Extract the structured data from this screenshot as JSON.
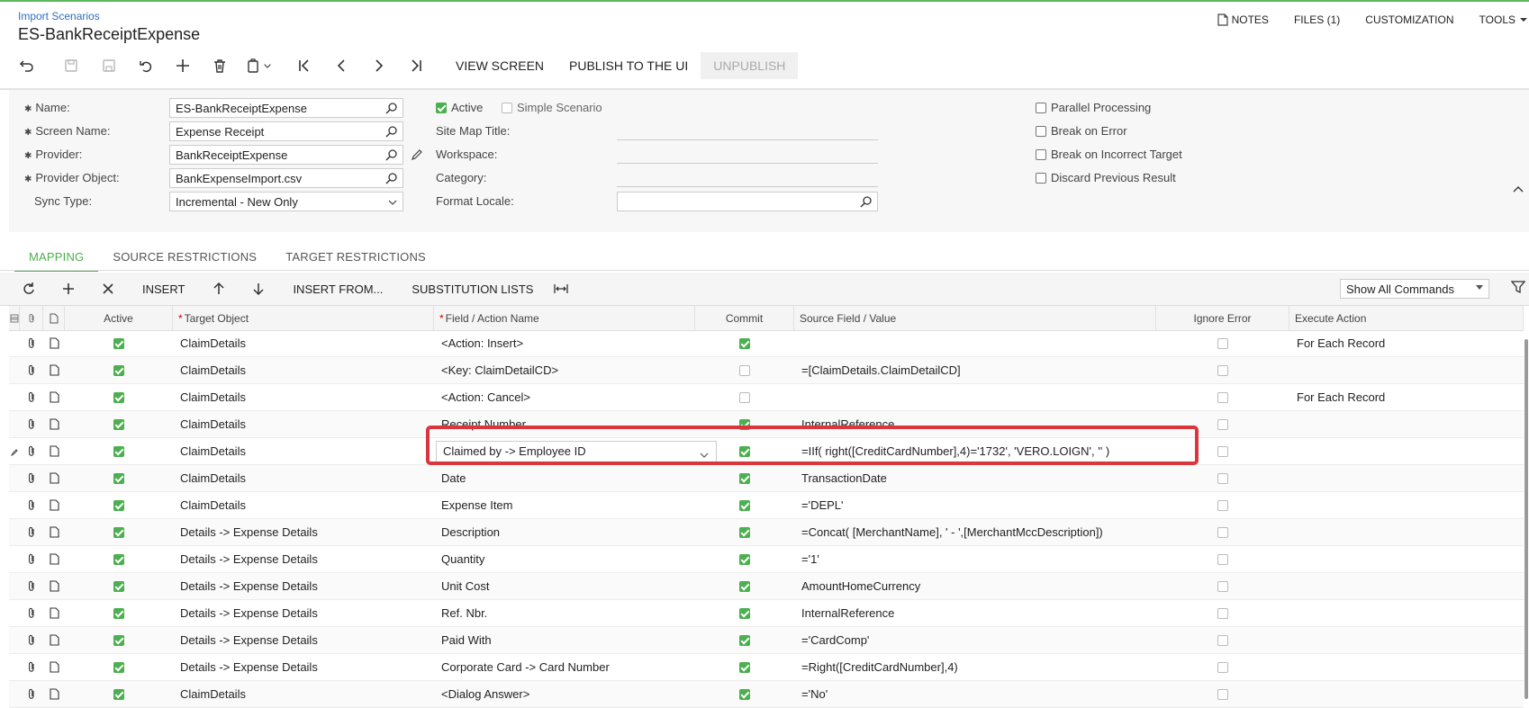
{
  "breadcrumb": "Import Scenarios",
  "title": "ES-BankReceiptExpense",
  "topmenu": {
    "notes": "NOTES",
    "files": "FILES (1)",
    "customization": "CUSTOMIZATION",
    "tools": "TOOLS"
  },
  "toolbar": {
    "view_screen": "VIEW SCREEN",
    "publish": "PUBLISH TO THE UI",
    "unpublish": "UNPUBLISH"
  },
  "form": {
    "name_label": "Name:",
    "name_value": "ES-BankReceiptExpense",
    "screen_label": "Screen Name:",
    "screen_value": "Expense Receipt",
    "provider_label": "Provider:",
    "provider_value": "BankReceiptExpense",
    "provider_object_label": "Provider Object:",
    "provider_object_value": "BankExpenseImport.csv",
    "sync_label": "Sync Type:",
    "sync_value": "Incremental - New Only",
    "active_label": "Active",
    "active_checked": true,
    "simple_label": "Simple Scenario",
    "simple_checked": false,
    "sitemap_label": "Site Map Title:",
    "workspace_label": "Workspace:",
    "category_label": "Category:",
    "locale_label": "Format Locale:",
    "parallel_label": "Parallel Processing",
    "break_error_label": "Break on Error",
    "break_target_label": "Break on Incorrect Target",
    "discard_label": "Discard Previous Result"
  },
  "tabs": [
    "MAPPING",
    "SOURCE RESTRICTIONS",
    "TARGET RESTRICTIONS"
  ],
  "gridtoolbar": {
    "insert": "INSERT",
    "insert_from": "INSERT FROM...",
    "substitution": "SUBSTITUTION LISTS",
    "commands": "Show All Commands"
  },
  "columns": {
    "active": "Active",
    "target": "Target Object",
    "field": "Field / Action Name",
    "commit": "Commit",
    "source": "Source Field / Value",
    "ignore": "Ignore Error",
    "execute": "Execute Action"
  },
  "rows": [
    {
      "active": true,
      "target": "ClaimDetails",
      "field": "<Action: Insert>",
      "commit": true,
      "source": "",
      "ignore": false,
      "execute": "For Each Record"
    },
    {
      "active": true,
      "target": "ClaimDetails",
      "field": "<Key: ClaimDetailCD>",
      "commit": false,
      "source": "=[ClaimDetails.ClaimDetailCD]",
      "ignore": false,
      "execute": ""
    },
    {
      "active": true,
      "target": "ClaimDetails",
      "field": "<Action: Cancel>",
      "commit": false,
      "source": "",
      "ignore": false,
      "execute": "For Each Record"
    },
    {
      "active": true,
      "target": "ClaimDetails",
      "field": "Receipt Number",
      "commit": true,
      "source": "InternalReference",
      "ignore": false,
      "execute": ""
    },
    {
      "active": true,
      "target": "ClaimDetails",
      "field": "Claimed by -> Employee ID",
      "commit": true,
      "source": "=IIf( right([CreditCardNumber],4)='1732', 'VERO.LOIGN', '' )",
      "ignore": false,
      "execute": "",
      "editing": true
    },
    {
      "active": true,
      "target": "ClaimDetails",
      "field": "Date",
      "commit": true,
      "source": "TransactionDate",
      "ignore": false,
      "execute": ""
    },
    {
      "active": true,
      "target": "ClaimDetails",
      "field": "Expense Item",
      "commit": true,
      "source": "='DEPL'",
      "ignore": false,
      "execute": ""
    },
    {
      "active": true,
      "target": "Details -> Expense Details",
      "field": "Description",
      "commit": true,
      "source": "=Concat( [MerchantName], ' - ',[MerchantMccDescription])",
      "ignore": false,
      "execute": ""
    },
    {
      "active": true,
      "target": "Details -> Expense Details",
      "field": "Quantity",
      "commit": true,
      "source": "='1'",
      "ignore": false,
      "execute": ""
    },
    {
      "active": true,
      "target": "Details -> Expense Details",
      "field": "Unit Cost",
      "commit": true,
      "source": "AmountHomeCurrency",
      "ignore": false,
      "execute": ""
    },
    {
      "active": true,
      "target": "Details -> Expense Details",
      "field": "Ref. Nbr.",
      "commit": true,
      "source": "InternalReference",
      "ignore": false,
      "execute": ""
    },
    {
      "active": true,
      "target": "Details -> Expense Details",
      "field": "Paid With",
      "commit": true,
      "source": "='CardComp'",
      "ignore": false,
      "execute": ""
    },
    {
      "active": true,
      "target": "Details -> Expense Details",
      "field": "Corporate Card -> Card Number",
      "commit": true,
      "source": "=Right([CreditCardNumber],4)",
      "ignore": false,
      "execute": ""
    },
    {
      "active": true,
      "target": "ClaimDetails",
      "field": "<Dialog Answer>",
      "commit": true,
      "source": "='No'",
      "ignore": false,
      "execute": ""
    }
  ],
  "colors": {
    "accent": "#4caf50",
    "link": "#2f6fba",
    "highlight": "#d9363e"
  }
}
